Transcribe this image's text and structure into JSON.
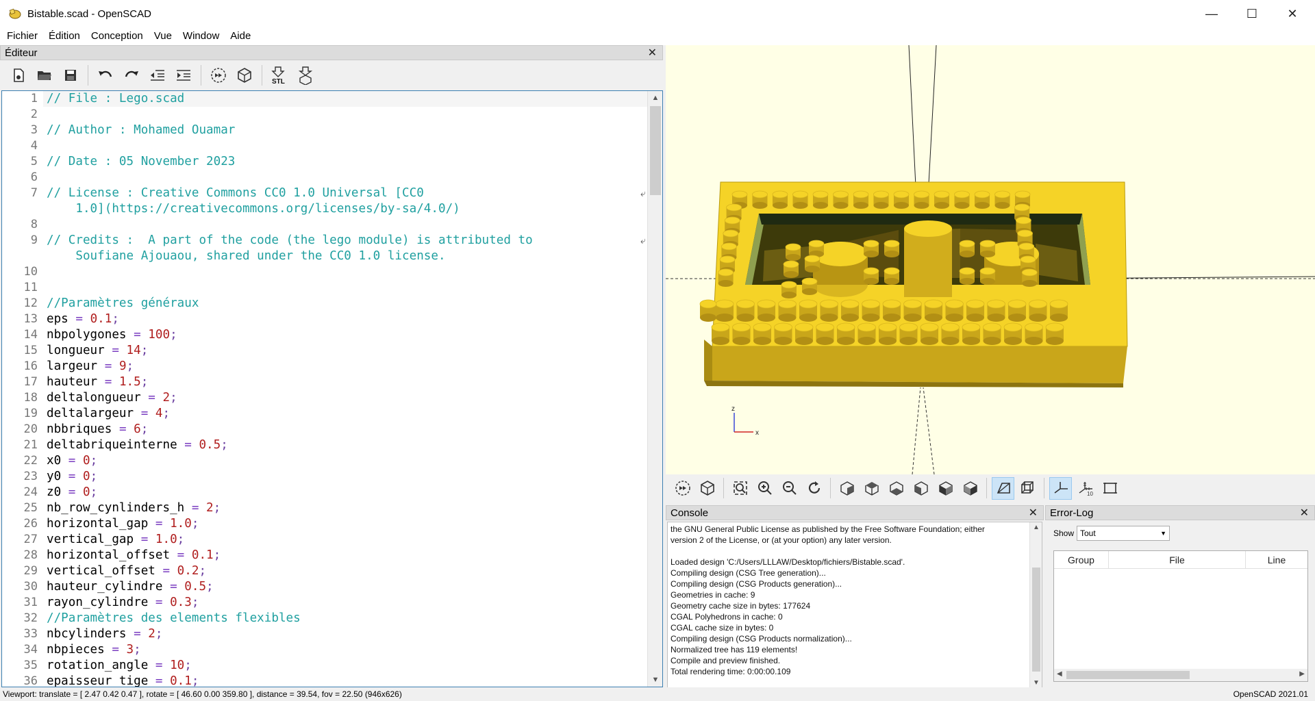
{
  "window": {
    "title": "Bistable.scad - OpenSCAD",
    "minimize": "—",
    "maximize": "☐",
    "close": "✕"
  },
  "menu": [
    "Fichier",
    "Édition",
    "Conception",
    "Vue",
    "Window",
    "Aide"
  ],
  "editor": {
    "title": "Éditeur",
    "close": "✕",
    "toolbar": [
      "new-file-icon",
      "open-file-icon",
      "save-icon",
      "undo-icon",
      "redo-icon",
      "unindent-icon",
      "indent-icon",
      "preview-icon",
      "render-icon",
      "export-stl-icon",
      "send-to-print-icon"
    ],
    "lines": [
      {
        "n": "1",
        "t": [
          [
            "cmt",
            "// File : Lego.scad"
          ]
        ]
      },
      {
        "n": "2",
        "t": []
      },
      {
        "n": "3",
        "t": [
          [
            "cmt",
            "// Author : Mohamed Ouamar"
          ]
        ]
      },
      {
        "n": "4",
        "t": []
      },
      {
        "n": "5",
        "t": [
          [
            "cmt",
            "// Date : 05 November 2023"
          ]
        ]
      },
      {
        "n": "6",
        "t": []
      },
      {
        "n": "7",
        "t": [
          [
            "cmt",
            "// License : Creative Commons CC0 1.0 Universal [CC0"
          ]
        ],
        "wrap": [
          [
            "cmt",
            "    1.0](https://creativecommons.org/licenses/by-sa/4.0/)"
          ]
        ]
      },
      {
        "n": "8",
        "t": []
      },
      {
        "n": "9",
        "t": [
          [
            "cmt",
            "// Credits :  A part of the code (the lego module) is attributed to"
          ]
        ],
        "wrap": [
          [
            "cmt",
            "    Soufiane Ajouaou, shared under the CC0 1.0 license."
          ]
        ]
      },
      {
        "n": "10",
        "t": []
      },
      {
        "n": "11",
        "t": []
      },
      {
        "n": "12",
        "t": [
          [
            "cmt",
            "//Paramètres généraux"
          ]
        ]
      },
      {
        "n": "13",
        "t": [
          [
            "",
            "eps "
          ],
          [
            "op",
            "="
          ],
          [
            "",
            " "
          ],
          [
            "num",
            "0.1"
          ],
          [
            "semi",
            ";"
          ]
        ]
      },
      {
        "n": "14",
        "t": [
          [
            "",
            "nbpolygones "
          ],
          [
            "op",
            "="
          ],
          [
            "",
            " "
          ],
          [
            "num",
            "100"
          ],
          [
            "semi",
            ";"
          ]
        ]
      },
      {
        "n": "15",
        "t": [
          [
            "",
            "longueur "
          ],
          [
            "op",
            "="
          ],
          [
            "",
            " "
          ],
          [
            "num",
            "14"
          ],
          [
            "semi",
            ";"
          ]
        ]
      },
      {
        "n": "16",
        "t": [
          [
            "",
            "largeur "
          ],
          [
            "op",
            "="
          ],
          [
            "",
            " "
          ],
          [
            "num",
            "9"
          ],
          [
            "semi",
            ";"
          ]
        ]
      },
      {
        "n": "17",
        "t": [
          [
            "",
            "hauteur "
          ],
          [
            "op",
            "="
          ],
          [
            "",
            " "
          ],
          [
            "num",
            "1.5"
          ],
          [
            "semi",
            ";"
          ]
        ]
      },
      {
        "n": "18",
        "t": [
          [
            "",
            "deltalongueur "
          ],
          [
            "op",
            "="
          ],
          [
            "",
            " "
          ],
          [
            "num",
            "2"
          ],
          [
            "semi",
            ";"
          ]
        ]
      },
      {
        "n": "19",
        "t": [
          [
            "",
            "deltalargeur "
          ],
          [
            "op",
            "="
          ],
          [
            "",
            " "
          ],
          [
            "num",
            "4"
          ],
          [
            "semi",
            ";"
          ]
        ]
      },
      {
        "n": "20",
        "t": [
          [
            "",
            "nbbriques "
          ],
          [
            "op",
            "="
          ],
          [
            "",
            " "
          ],
          [
            "num",
            "6"
          ],
          [
            "semi",
            ";"
          ]
        ]
      },
      {
        "n": "21",
        "t": [
          [
            "",
            "deltabriqueinterne "
          ],
          [
            "op",
            "="
          ],
          [
            "",
            " "
          ],
          [
            "num",
            "0.5"
          ],
          [
            "semi",
            ";"
          ]
        ]
      },
      {
        "n": "22",
        "t": [
          [
            "",
            "x0 "
          ],
          [
            "op",
            "="
          ],
          [
            "",
            " "
          ],
          [
            "num",
            "0"
          ],
          [
            "semi",
            ";"
          ]
        ]
      },
      {
        "n": "23",
        "t": [
          [
            "",
            "y0 "
          ],
          [
            "op",
            "="
          ],
          [
            "",
            " "
          ],
          [
            "num",
            "0"
          ],
          [
            "semi",
            ";"
          ]
        ]
      },
      {
        "n": "24",
        "t": [
          [
            "",
            "z0 "
          ],
          [
            "op",
            "="
          ],
          [
            "",
            " "
          ],
          [
            "num",
            "0"
          ],
          [
            "semi",
            ";"
          ]
        ]
      },
      {
        "n": "25",
        "t": [
          [
            "",
            "nb_row_cynlinders_h "
          ],
          [
            "op",
            "="
          ],
          [
            "",
            " "
          ],
          [
            "num",
            "2"
          ],
          [
            "semi",
            ";"
          ]
        ]
      },
      {
        "n": "26",
        "t": [
          [
            "",
            "horizontal_gap "
          ],
          [
            "op",
            "="
          ],
          [
            "",
            " "
          ],
          [
            "num",
            "1.0"
          ],
          [
            "semi",
            ";"
          ]
        ]
      },
      {
        "n": "27",
        "t": [
          [
            "",
            "vertical_gap "
          ],
          [
            "op",
            "="
          ],
          [
            "",
            " "
          ],
          [
            "num",
            "1.0"
          ],
          [
            "semi",
            ";"
          ]
        ]
      },
      {
        "n": "28",
        "t": [
          [
            "",
            "horizontal_offset "
          ],
          [
            "op",
            "="
          ],
          [
            "",
            " "
          ],
          [
            "num",
            "0.1"
          ],
          [
            "semi",
            ";"
          ]
        ]
      },
      {
        "n": "29",
        "t": [
          [
            "",
            "vertical_offset "
          ],
          [
            "op",
            "="
          ],
          [
            "",
            " "
          ],
          [
            "num",
            "0.2"
          ],
          [
            "semi",
            ";"
          ]
        ]
      },
      {
        "n": "30",
        "t": [
          [
            "",
            "hauteur_cylindre "
          ],
          [
            "op",
            "="
          ],
          [
            "",
            " "
          ],
          [
            "num",
            "0.5"
          ],
          [
            "semi",
            ";"
          ]
        ]
      },
      {
        "n": "31",
        "t": [
          [
            "",
            "rayon_cylindre "
          ],
          [
            "op",
            "="
          ],
          [
            "",
            " "
          ],
          [
            "num",
            "0.3"
          ],
          [
            "semi",
            ";"
          ]
        ]
      },
      {
        "n": "32",
        "t": [
          [
            "cmt",
            "//Paramètres des elements flexibles"
          ]
        ]
      },
      {
        "n": "33",
        "t": [
          [
            "",
            "nbcylinders "
          ],
          [
            "op",
            "="
          ],
          [
            "",
            " "
          ],
          [
            "num",
            "2"
          ],
          [
            "semi",
            ";"
          ]
        ]
      },
      {
        "n": "34",
        "t": [
          [
            "",
            "nbpieces "
          ],
          [
            "op",
            "="
          ],
          [
            "",
            " "
          ],
          [
            "num",
            "3"
          ],
          [
            "semi",
            ";"
          ]
        ]
      },
      {
        "n": "35",
        "t": [
          [
            "",
            "rotation_angle "
          ],
          [
            "op",
            "="
          ],
          [
            "",
            " "
          ],
          [
            "num",
            "10"
          ],
          [
            "semi",
            ";"
          ]
        ]
      },
      {
        "n": "36",
        "t": [
          [
            "",
            "epaisseur_tige "
          ],
          [
            "op",
            "="
          ],
          [
            "",
            " "
          ],
          [
            "num",
            "0.1"
          ],
          [
            "semi",
            ";"
          ]
        ]
      }
    ]
  },
  "viewport": {
    "axis_z": "z",
    "axis_x": "x",
    "background": "#ffffe6",
    "brick_color": "#f5d327"
  },
  "view_toolbar": [
    "preview-icon",
    "render-icon",
    "view-all-icon",
    "zoom-in-icon",
    "zoom-out-icon",
    "reset-view-icon",
    "view-right-icon",
    "view-top-icon",
    "view-bottom-icon",
    "view-left-icon",
    "view-front-icon",
    "view-back-icon",
    "perspective-icon",
    "orthogonal-icon",
    "show-axes-icon",
    "show-scale-markers-icon",
    "show-edges-icon"
  ],
  "console": {
    "title": "Console",
    "close": "✕",
    "lines": [
      "the GNU General Public License as published by the Free Software Foundation; either",
      "version 2 of the License, or (at your option) any later version.",
      "",
      "Loaded design 'C:/Users/LLLAW/Desktop/fichiers/Bistable.scad'.",
      "Compiling design (CSG Tree generation)...",
      "Compiling design (CSG Products generation)...",
      "Geometries in cache: 9",
      "Geometry cache size in bytes: 177624",
      "CGAL Polyhedrons in cache: 0",
      "CGAL cache size in bytes: 0",
      "Compiling design (CSG Products normalization)...",
      "Normalized tree has 119 elements!",
      "Compile and preview finished.",
      "Total rendering time: 0:00:00.109"
    ]
  },
  "errorlog": {
    "title": "Error-Log",
    "close": "✕",
    "show_label": "Show",
    "show_value": "Tout",
    "columns": [
      "Group",
      "File",
      "Line"
    ]
  },
  "status": {
    "viewport": "Viewport: translate = [ 2.47 0.42 0.47 ], rotate = [ 46.60 0.00 359.80 ], distance = 39.54, fov = 22.50 (946x626)",
    "version": "OpenSCAD 2021.01"
  }
}
